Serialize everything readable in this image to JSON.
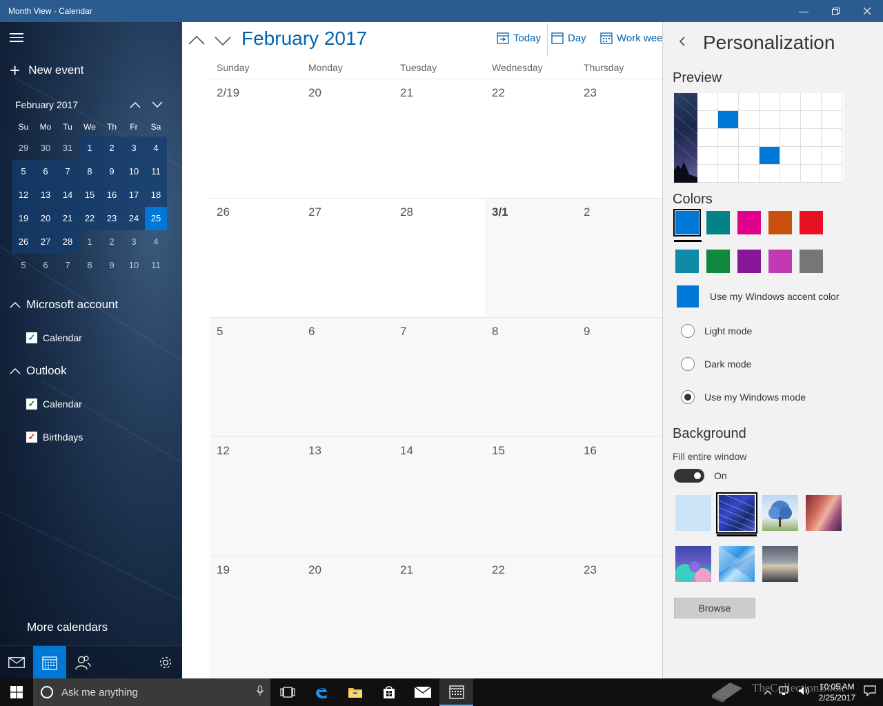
{
  "window": {
    "title": "Month View - Calendar"
  },
  "sidebar": {
    "new_event": "New event",
    "minical": {
      "title": "February 2017",
      "dow": [
        "Su",
        "Mo",
        "Tu",
        "We",
        "Th",
        "Fr",
        "Sa"
      ],
      "weeks": [
        [
          "29",
          "30",
          "31",
          "1",
          "2",
          "3",
          "4"
        ],
        [
          "5",
          "6",
          "7",
          "8",
          "9",
          "10",
          "11"
        ],
        [
          "12",
          "13",
          "14",
          "15",
          "16",
          "17",
          "18"
        ],
        [
          "19",
          "20",
          "21",
          "22",
          "23",
          "24",
          "25"
        ],
        [
          "26",
          "27",
          "28",
          "1",
          "2",
          "3",
          "4"
        ],
        [
          "5",
          "6",
          "7",
          "8",
          "9",
          "10",
          "11"
        ]
      ]
    },
    "accounts": [
      {
        "name": "Microsoft account",
        "calendars": [
          {
            "label": "Calendar",
            "color": "#0078d7"
          }
        ]
      },
      {
        "name": "Outlook",
        "calendars": [
          {
            "label": "Calendar",
            "color": "#10893e"
          },
          {
            "label": "Birthdays",
            "color": "#d13438"
          }
        ]
      }
    ],
    "more_calendars": "More calendars"
  },
  "main": {
    "month_title": "February 2017",
    "toolbar": {
      "today": "Today",
      "day": "Day",
      "work_week": "Work week"
    },
    "dow": [
      "Sunday",
      "Monday",
      "Tuesday",
      "Wednesday",
      "Thursday"
    ],
    "rows": [
      [
        "2/19",
        "20",
        "21",
        "22",
        "23"
      ],
      [
        "26",
        "27",
        "28",
        "3/1",
        "2"
      ],
      [
        "5",
        "6",
        "7",
        "8",
        "9"
      ],
      [
        "12",
        "13",
        "14",
        "15",
        "16"
      ],
      [
        "19",
        "20",
        "21",
        "22",
        "23"
      ]
    ]
  },
  "panel": {
    "title": "Personalization",
    "preview_label": "Preview",
    "colors_label": "Colors",
    "colors": [
      "#0078d7",
      "#038387",
      "#e3008c",
      "#ca5010",
      "#e81123",
      "#0e8aa6",
      "#10893e",
      "#881798",
      "#c239b3",
      "#767676"
    ],
    "accent_label": "Use my Windows accent color",
    "modes": [
      {
        "label": "Light mode",
        "checked": false
      },
      {
        "label": "Dark mode",
        "checked": false
      },
      {
        "label": "Use my Windows mode",
        "checked": true
      }
    ],
    "background_label": "Background",
    "fill_label": "Fill entire window",
    "toggle_state": "On",
    "browse": "Browse"
  },
  "taskbar": {
    "search_placeholder": "Ask me anything",
    "time": "10:05 AM",
    "date": "2/25/2017"
  },
  "watermark": "TheCollectionBook"
}
